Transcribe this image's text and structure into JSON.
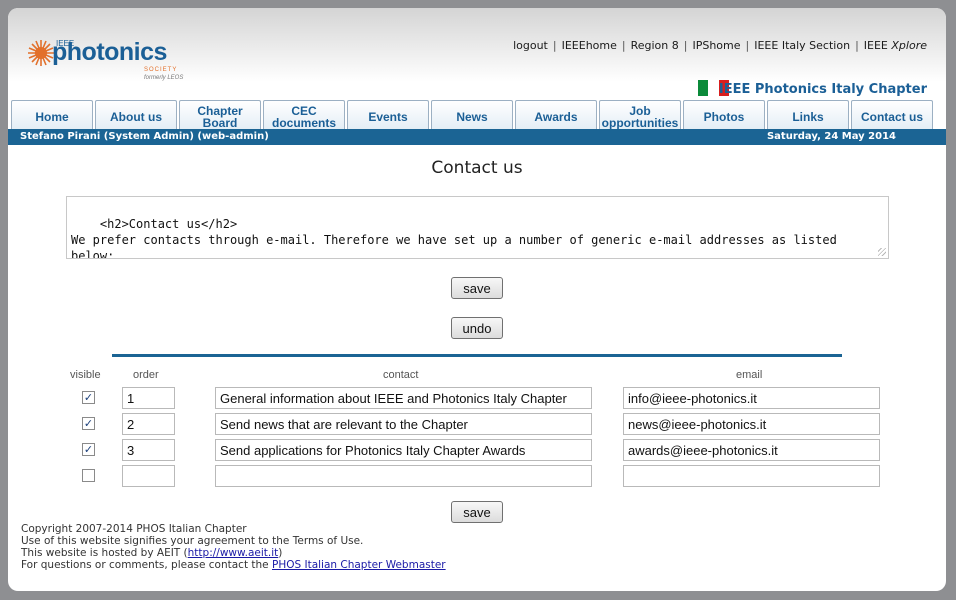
{
  "header": {
    "logo": {
      "ieee": "IEEE",
      "name": "photonics",
      "society": "SOCIETY",
      "formerly": "formerly LEOS"
    },
    "links": [
      "logout",
      "IEEEhome",
      "Region 8",
      "IPShome",
      "IEEE Italy Section",
      "IEEE",
      "Xplore"
    ],
    "chapter_title": "IEEE Photonics Italy Chapter",
    "flag_colors": [
      "#0b8a3a",
      "#ffffff",
      "#d81e1e"
    ]
  },
  "nav": {
    "tabs": [
      {
        "label": "Home"
      },
      {
        "label": "About us"
      },
      {
        "label": "Chapter Board"
      },
      {
        "label": "CEC documents"
      },
      {
        "label": "Events"
      },
      {
        "label": "News"
      },
      {
        "label": "Awards"
      },
      {
        "label": "Job opportunities"
      },
      {
        "label": "Photos"
      },
      {
        "label": "Links"
      },
      {
        "label": "Contact us"
      }
    ]
  },
  "userbar": {
    "user": "Stefano Pirani (System Admin) (web-admin)",
    "date": "Saturday, 24 May 2014"
  },
  "main": {
    "title": "Contact us",
    "editor_text": "<h2>Contact us</h2>\nWe prefer contacts through e-mail. Therefore we have set up a number of generic e-mail addresses as listed below:",
    "save_label": "save",
    "undo_label": "undo",
    "columns": {
      "visible": "visible",
      "order": "order",
      "contact": "contact",
      "email": "email"
    },
    "rows": [
      {
        "visible": true,
        "order": "1",
        "contact": "General information about IEEE and Photonics Italy Chapter",
        "email": "info@ieee-photonics.it"
      },
      {
        "visible": true,
        "order": "2",
        "contact": "Send news that are relevant to the Chapter",
        "email": "news@ieee-photonics.it"
      },
      {
        "visible": true,
        "order": "3",
        "contact": "Send applications for Photonics Italy Chapter Awards",
        "email": "awards@ieee-photonics.it"
      },
      {
        "visible": false,
        "order": "",
        "contact": "",
        "email": ""
      }
    ],
    "save2_label": "save"
  },
  "footer": {
    "line1": "Copyright 2007-2014 PHOS Italian Chapter",
    "line2": "Use of this website signifies your agreement to the Terms of Use.",
    "line3_prefix": "This website is hosted by AEIT (",
    "line3_link": "http://www.aeit.it",
    "line3_suffix": ")",
    "line4_prefix": "For questions or comments, please contact the ",
    "line4_link": "PHOS Italian Chapter Webmaster"
  },
  "colors": {
    "accent": "#1b6494",
    "link": "#1b5f96"
  }
}
